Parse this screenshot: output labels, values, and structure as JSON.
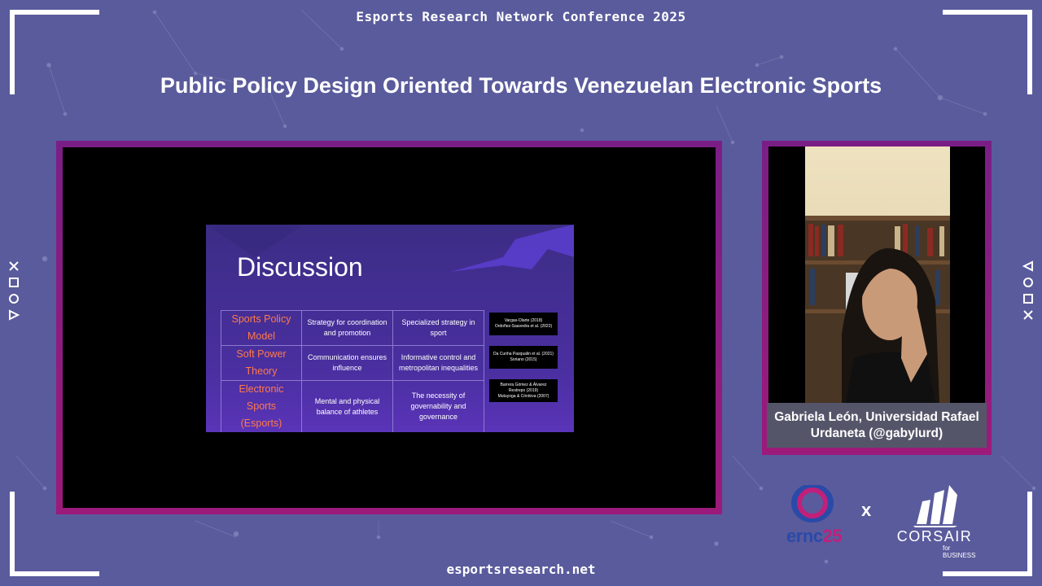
{
  "header": {
    "conference": "Esports Research Network Conference 2025",
    "talk_title": "Public Policy Design Oriented Towards Venezuelan Electronic Sports"
  },
  "footer": {
    "url": "esportsresearch.net"
  },
  "slide": {
    "title": "Discussion",
    "rows": [
      {
        "term": "Sports Policy Model",
        "col2": "Strategy for coordination and promotion",
        "col3": "Specialized strategy in sport",
        "ref": [
          "Vargas-Olarte (2018)",
          "Ordoñez-Saavedra et al. (2022)"
        ]
      },
      {
        "term": "Soft Power Theory",
        "col2": "Communication ensures influence",
        "col3": "Informative control and metropolitan inequalities",
        "ref": [
          "Da Cunha Pasqualin et al. (2021)",
          "Soriano (2015)"
        ]
      },
      {
        "term": "Electronic Sports (Esports)",
        "col2": "Mental and physical balance of athletes",
        "col3": "The necessity of governability and governance",
        "ref": [
          "Barrera Gómez & Álvarez",
          "Restrepo (2019)",
          "Mutuyoga & Córdova (2007)"
        ]
      }
    ]
  },
  "speaker": {
    "line1": "Gabriela León, Universidad Rafael",
    "line2": "Urdaneta (@gabylurd)"
  },
  "sponsors": {
    "ernc": {
      "text_main": "ernc",
      "text_year": "25"
    },
    "times": "x",
    "corsair": {
      "name": "CORSAIR",
      "sub": "for BUSINESS"
    }
  },
  "side_icons": {
    "left": [
      "cross-icon",
      "square-icon",
      "circle-icon",
      "triangle-icon"
    ],
    "right": [
      "triangle-icon",
      "circle-icon",
      "square-icon",
      "cross-icon"
    ]
  },
  "colors": {
    "background": "#5a5b9c",
    "frame": "#8c1c80",
    "slide_term": "#ff7a4a",
    "ernc_blue": "#2a4aa8",
    "ernc_magenta": "#c0207a"
  }
}
